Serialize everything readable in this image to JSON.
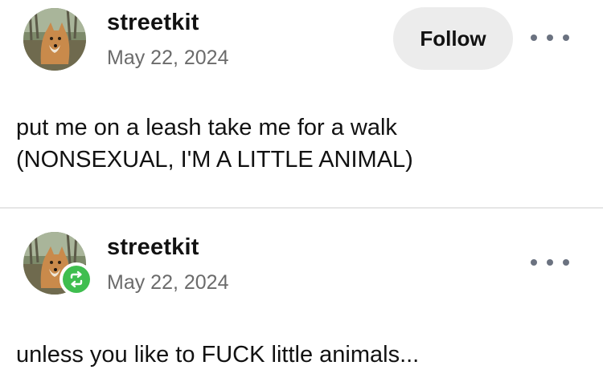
{
  "posts": [
    {
      "username": "streetkit",
      "date": "May 22, 2024",
      "follow_label": "Follow",
      "more_icon": "more-horizontal-icon",
      "body_lines": [
        "put me on a leash take me for a walk",
        "(NONSEXUAL, I'M A LITTLE ANIMAL)"
      ]
    },
    {
      "username": "streetkit",
      "date": "May 22, 2024",
      "reblog_icon": "reblog-icon",
      "more_icon": "more-horizontal-icon",
      "body_lines": [
        "unless you like to FUCK little animals..."
      ]
    }
  ],
  "colors": {
    "follow_button_bg": "#ececec",
    "reblog_badge": "#3fbe4f",
    "date_text": "#6b6b6b",
    "divider": "#e6e6e6"
  }
}
